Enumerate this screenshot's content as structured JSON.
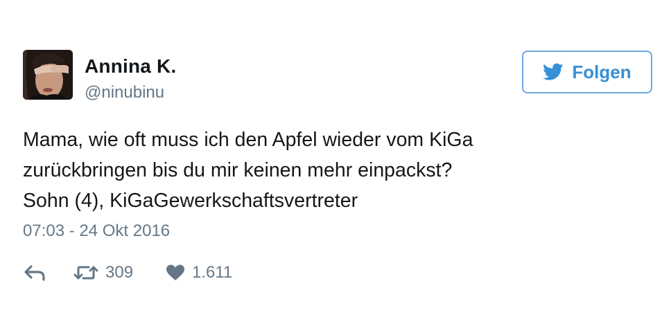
{
  "user": {
    "display_name": "Annina K.",
    "handle": "@ninubinu"
  },
  "follow_button": {
    "label": "Folgen",
    "icon": "twitter-bird-icon",
    "color": "#3590d7"
  },
  "tweet": {
    "lines": [
      "Mama, wie oft muss ich den Apfel wieder vom KiGa",
      "zurückbringen bis du mir keinen mehr einpackst?",
      "Sohn (4), KiGaGewerkschaftsvertreter"
    ],
    "timestamp": "07:03 - 24 Okt 2016"
  },
  "actions": {
    "reply": {
      "icon": "reply-icon"
    },
    "retweet": {
      "icon": "retweet-icon",
      "count": "309"
    },
    "like": {
      "icon": "heart-icon",
      "count": "1.611"
    }
  },
  "colors": {
    "text": "#14171a",
    "secondary": "#657786",
    "accent": "#3590d7"
  }
}
